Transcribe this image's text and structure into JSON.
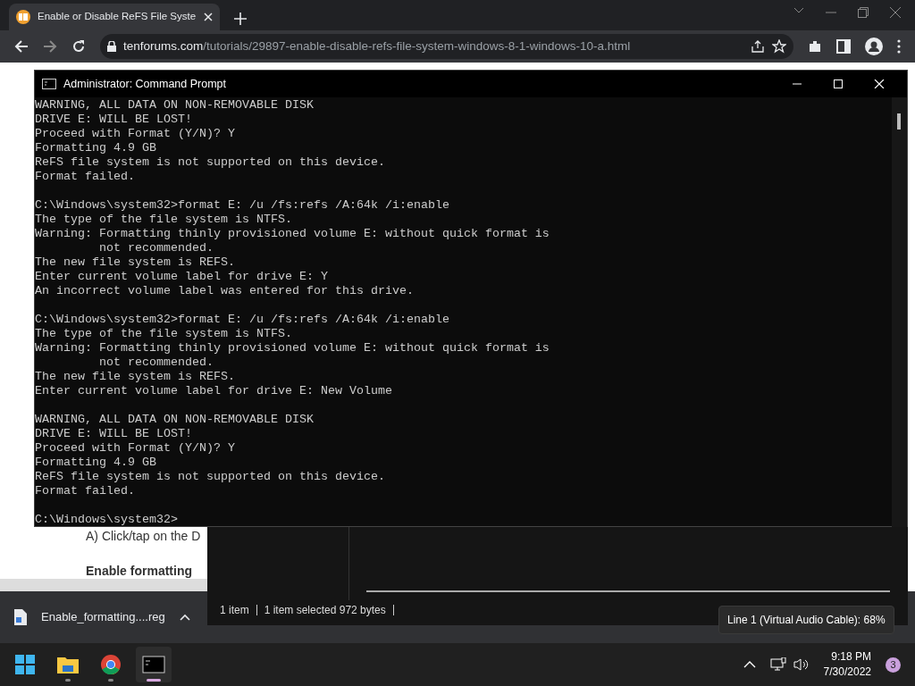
{
  "browser": {
    "tab_title": "Enable or Disable ReFS File Syste",
    "address_domain": "tenforums.com",
    "address_path": "/tutorials/29897-enable-disable-refs-file-system-windows-8-1-windows-10-a.html"
  },
  "page_text": [
    {
      "text": "A) Click/tap on the D",
      "bold": false
    },
    {
      "text": "Enable formatting",
      "bold": true
    }
  ],
  "console": {
    "title": "Administrator: Command Prompt",
    "blocks": [
      [
        "WARNING, ALL DATA ON NON-REMOVABLE DISK",
        "DRIVE E: WILL BE LOST!",
        "Proceed with Format (Y/N)? Y",
        "Formatting 4.9 GB",
        "ReFS file system is not supported on this device.",
        "Format failed."
      ],
      [
        "C:\\Windows\\system32>format E: /u /fs:refs /A:64k /i:enable",
        "The type of the file system is NTFS.",
        "Warning: Formatting thinly provisioned volume E: without quick format is",
        "         not recommended.",
        "The new file system is REFS.",
        "Enter current volume label for drive E: Y",
        "An incorrect volume label was entered for this drive."
      ],
      [
        "C:\\Windows\\system32>format E: /u /fs:refs /A:64k /i:enable",
        "The type of the file system is NTFS.",
        "Warning: Formatting thinly provisioned volume E: without quick format is",
        "         not recommended.",
        "The new file system is REFS.",
        "Enter current volume label for drive E: New Volume"
      ],
      [
        "WARNING, ALL DATA ON NON-REMOVABLE DISK",
        "DRIVE E: WILL BE LOST!",
        "Proceed with Format (Y/N)? Y",
        "Formatting 4.9 GB",
        "ReFS file system is not supported on this device.",
        "Format failed."
      ],
      [
        "C:\\Windows\\system32>"
      ]
    ]
  },
  "explorer_status": [
    "1 item",
    "1 item selected  972 bytes"
  ],
  "download": {
    "filename": "Enable_formatting....reg"
  },
  "tooltip": "Line 1 (Virtual Audio Cable): 68%",
  "taskbar": {
    "apps": [
      {
        "kind": "start",
        "selected": false
      },
      {
        "kind": "folder",
        "selected": false
      },
      {
        "kind": "chrome",
        "selected": false
      },
      {
        "kind": "console",
        "selected": true
      }
    ],
    "time": "9:18 PM",
    "date": "7/30/2022",
    "notifications": "3"
  }
}
